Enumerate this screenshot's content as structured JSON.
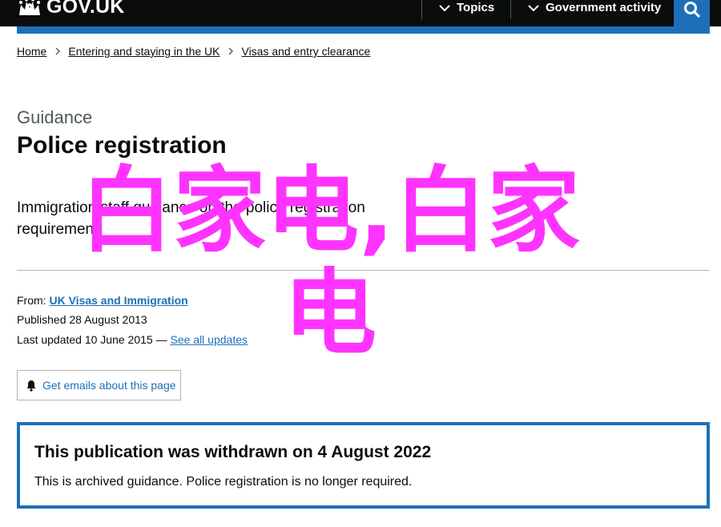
{
  "header": {
    "logo_text": "GOV.UK",
    "nav": {
      "topics_label": "Topics",
      "government_activity_label": "Government activity"
    },
    "search_icon": "search-icon"
  },
  "breadcrumbs": [
    "Home",
    "Entering and staying in the UK",
    "Visas and entry clearance"
  ],
  "page": {
    "guidance_label": "Guidance",
    "title": "Police registration",
    "description": "Immigration staff guidance on the police registration requirement."
  },
  "meta": {
    "from_label": "From:",
    "from_org": "UK Visas and Immigration",
    "published": "Published 28 August 2013",
    "last_updated": "Last updated 10 June 2015 —",
    "see_all_updates": "See all updates"
  },
  "email_button": {
    "label": "Get emails about this page",
    "icon": "bell-icon"
  },
  "withdrawn_notice": {
    "title": "This publication was withdrawn on 4 August 2022",
    "text": "This is archived guidance. Police registration is no longer required."
  },
  "watermark": "白家电,白家电",
  "colors": {
    "header_bg": "#0b0c0c",
    "link": "#1d70b8",
    "watermark": "#ff33ff",
    "secondary_text": "#505a5f"
  }
}
